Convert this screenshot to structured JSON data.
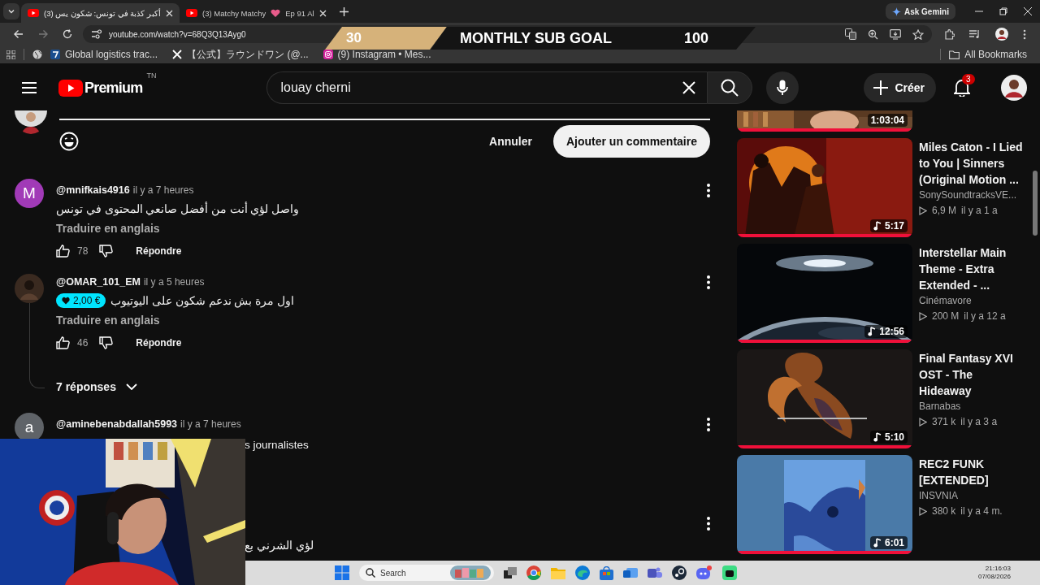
{
  "browser": {
    "tabs": [
      {
        "title": "(3) أكبر كذبة في تونس: شكون يس",
        "selected": true
      },
      {
        "title": "(3) Matchy Matchy",
        "title_after": "Ep 91 Al",
        "selected": false
      }
    ],
    "ask_gemini": "Ask Gemini",
    "url": "youtube.com/watch?v=68Q3Q13Ayg0",
    "bookmarks": [
      {
        "label": "Global logistics trac..."
      },
      {
        "label": "【公式】ラウンドワン (@..."
      },
      {
        "label": "(9) Instagram • Mes..."
      }
    ],
    "all_bookmarks": "All Bookmarks"
  },
  "stream_overlay": {
    "current": "30",
    "title": "MONTHLY SUB GOAL",
    "goal": "100"
  },
  "header": {
    "logo": "Premium",
    "country": "TN",
    "search": "louay cherni",
    "create": "Créer",
    "notifications": "3"
  },
  "comment_box": {
    "cancel": "Annuler",
    "submit": "Ajouter un commentaire"
  },
  "comments": [
    {
      "kind": "full",
      "avatar": {
        "kind": "letter",
        "letter": "M",
        "color": "#a13ab7"
      },
      "author": "@mnifkais4916",
      "time": "il y a 7 heures",
      "text": "واصل لؤي أنت من أفضل صانعي المحتوى في تونس",
      "translate": "Traduire en anglais",
      "likes": "78",
      "reply": "Répondre"
    },
    {
      "kind": "full",
      "author": "@OMAR_101_EM",
      "time": "il y a 5 heures",
      "donation": "2,00 €",
      "text": "اول مرة بش ندعم شكون على اليوتيوب",
      "translate": "Traduire en anglais",
      "likes": "46",
      "reply": "Répondre",
      "replies": "7 réponses"
    },
    {
      "kind": "partial",
      "avatar": {
        "kind": "letter",
        "letter": "a",
        "color": "#5f6368"
      },
      "author": "@aminebenabdallah5993",
      "time": "il y a 7 heures",
      "text": "s journalistes"
    },
    {
      "kind": "partial",
      "text": "لؤي الشرني بع"
    }
  ],
  "videos": [
    {
      "kind": "partial",
      "duration": "1:03:04",
      "level": 1
    },
    {
      "kind": "full",
      "title": "Miles Caton - I Lied to You | Sinners (Original Motion ...",
      "channel": "SonySoundtracksVE...",
      "views": "6,9 M",
      "age": "il y a 1 a",
      "duration": "5:17",
      "level": 1
    },
    {
      "kind": "full",
      "title": "Interstellar Main Theme - Extra Extended - ...",
      "channel": "Cinémavore",
      "views": "200 M",
      "age": "il y a 12 a",
      "duration": "12:56",
      "level": 1
    },
    {
      "kind": "full",
      "title": "Final Fantasy XVI OST - The Hideaway",
      "channel": "Barnabas",
      "views": "371 k",
      "age": "il y a 3 a",
      "duration": "5:10",
      "level": 1
    },
    {
      "kind": "full",
      "title": "REC2 FUNK [EXTENDED]",
      "channel": "INSVNIA",
      "views": "380 k",
      "age": "il y a 4 m.",
      "duration": "6:01",
      "level": 1
    }
  ],
  "taskbar": {
    "search": "Search",
    "time": "21:16:03",
    "date": "07/08/2026"
  }
}
